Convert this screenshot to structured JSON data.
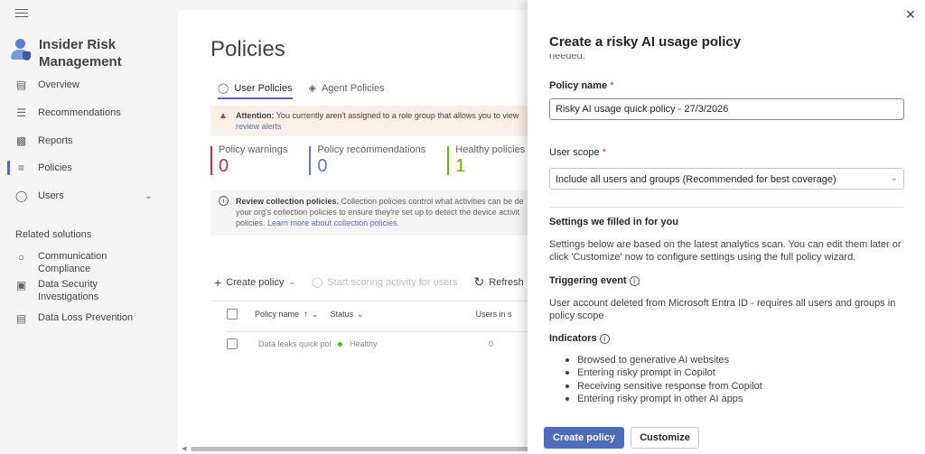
{
  "nav": {
    "app_title": "Insider Risk Management",
    "items": [
      {
        "label": "Overview",
        "icon": "book-icon"
      },
      {
        "label": "Recommendations",
        "icon": "list-icon"
      },
      {
        "label": "Reports",
        "icon": "chart-icon"
      },
      {
        "label": "Policies",
        "icon": "sliders-icon"
      },
      {
        "label": "Users",
        "icon": "person-icon"
      }
    ],
    "related_header": "Related solutions",
    "related": [
      {
        "label": "Communication Compliance",
        "icon": "chat-search-icon"
      },
      {
        "label": "Data Security Investigations",
        "icon": "data-search-icon"
      },
      {
        "label": "Data Loss Prevention",
        "icon": "document-lock-icon"
      }
    ]
  },
  "main": {
    "title": "Policies",
    "tabs": [
      {
        "label": "User Policies",
        "icon": "person-icon"
      },
      {
        "label": "Agent Policies",
        "icon": "agent-icon"
      }
    ],
    "alert": {
      "bold": "Attention:",
      "text": " You currently aren't assigned to a role group that allows you to view",
      "link": "review alerts"
    },
    "metrics": [
      {
        "label": "Policy warnings",
        "value": "0",
        "color": "#c4314b"
      },
      {
        "label": "Policy recommendations",
        "value": "0",
        "color": "#6b7ab7"
      },
      {
        "label": "Healthy policies",
        "value": "1",
        "color": "#6bb700"
      }
    ],
    "info": {
      "bold": "Review collection policies.",
      "text1": " Collection policies control what activities can be de",
      "text2": "your org's collection policies to ensure they're set up to detect the device activit",
      "text3": "policies. ",
      "link": "Learn more about collection policies."
    },
    "toolbar": {
      "create": "Create policy",
      "scoring": "Start scoring activity for users",
      "refresh": "Refresh"
    },
    "table": {
      "columns": [
        "Policy name",
        "Status",
        "Users in s"
      ],
      "rows": [
        {
          "name": "Data leaks quick pol",
          "status": "Healthy",
          "users": "0"
        }
      ]
    }
  },
  "panel": {
    "title": "Create a risky AI usage policy",
    "cut_text": "needed.",
    "policy_name_label": "Policy name",
    "required_mark": "*",
    "policy_name_value": "Risky AI usage quick policy - 27/3/2026",
    "user_scope_label": "User scope",
    "user_scope_value": "Include all users and groups (Recommended for best coverage)",
    "settings_title": "Settings we filled in for you",
    "settings_text": "Settings below are based on the latest analytics scan. You can edit them later or click 'Customize' now to configure settings using the full policy wizard.",
    "triggering_title": "Triggering event",
    "triggering_text": "User account deleted from Microsoft Entra ID - requires all users and groups in policy scope",
    "indicators_title": "Indicators",
    "indicators": [
      "Browsed to generative AI websites",
      "Entering risky prompt in Copilot",
      "Receiving sensitive response from Copilot",
      "Entering risky prompt in other AI apps"
    ],
    "create_button": "Create policy",
    "customize_button": "Customize"
  }
}
